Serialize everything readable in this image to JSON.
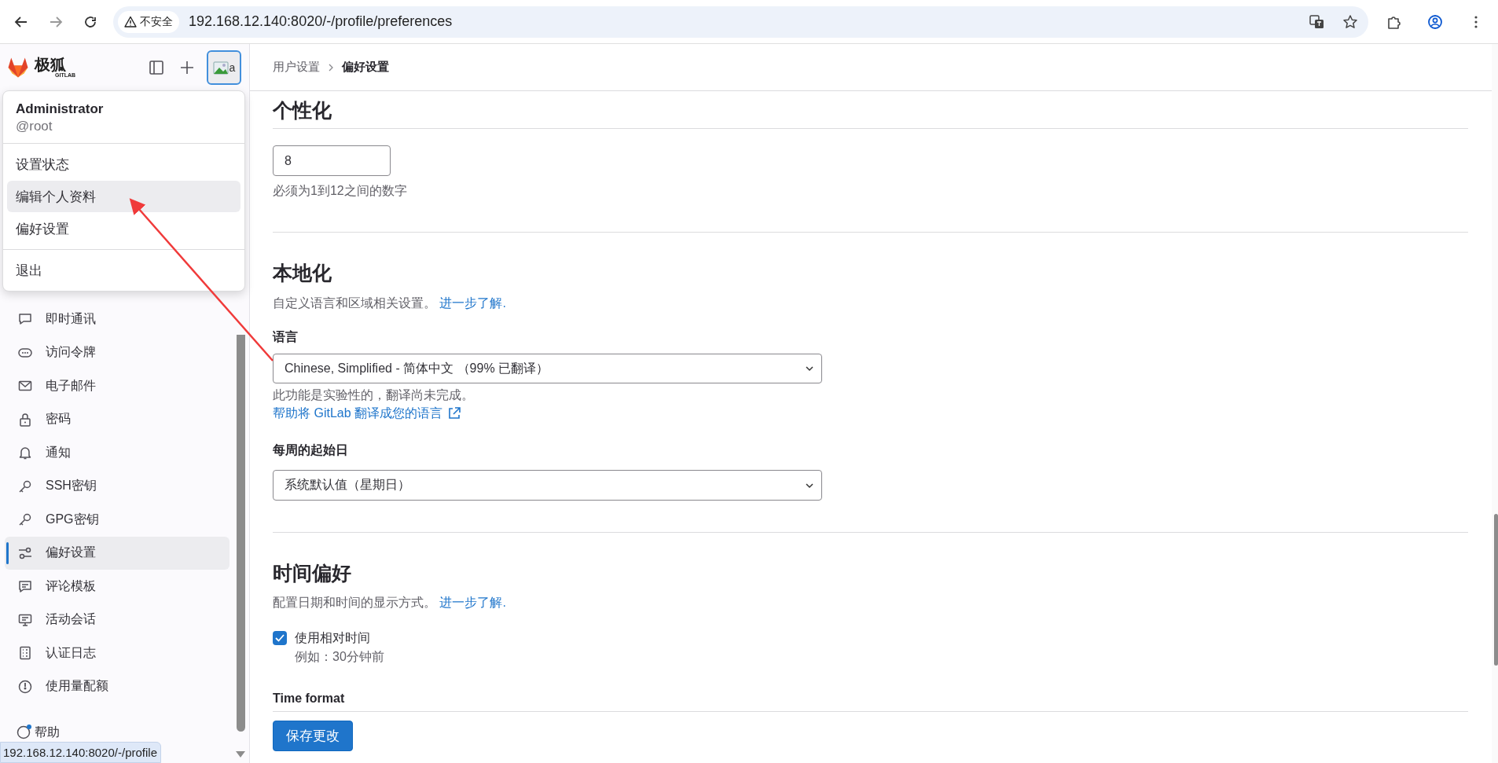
{
  "browser": {
    "security_label": "不安全",
    "url": "192.168.12.140:8020/-/profile/preferences"
  },
  "sidebar": {
    "brand": "极狐",
    "brand_sub": "GITLAB",
    "avatar_alt": "a",
    "items": [
      {
        "label": "即时通讯",
        "selected": false
      },
      {
        "label": "访问令牌",
        "selected": false
      },
      {
        "label": "电子邮件",
        "selected": false
      },
      {
        "label": "密码",
        "selected": false
      },
      {
        "label": "通知",
        "selected": false
      },
      {
        "label": "SSH密钥",
        "selected": false
      },
      {
        "label": "GPG密钥",
        "selected": false
      },
      {
        "label": "偏好设置",
        "selected": true
      },
      {
        "label": "评论模板",
        "selected": false
      },
      {
        "label": "活动会话",
        "selected": false
      },
      {
        "label": "认证日志",
        "selected": false
      },
      {
        "label": "使用量配额",
        "selected": false
      }
    ],
    "help": "帮助"
  },
  "user_menu": {
    "name": "Administrator",
    "username": "@root",
    "items": [
      {
        "label": "设置状态",
        "selected": false
      },
      {
        "label": "编辑个人资料",
        "selected": true
      },
      {
        "label": "偏好设置",
        "selected": false
      }
    ],
    "sign_out": "退出"
  },
  "breadcrumb": [
    "用户设置",
    "偏好设置"
  ],
  "personalization": {
    "title": "个性化",
    "value": "8",
    "help": "必须为1到12之间的数字"
  },
  "localization": {
    "title": "本地化",
    "description": "自定义语言和区域相关设置。",
    "learn_more": "进一步了解.",
    "language_label": "语言",
    "language_value": "Chinese, Simplified - 简体中文 （99% 已翻译）",
    "note": "此功能是实验性的，翻译尚未完成。",
    "help_link": "帮助将 GitLab 翻译成您的语言",
    "week_label": "每周的起始日",
    "week_value": "系统默认值（星期日）"
  },
  "time": {
    "title": "时间偏好",
    "description": "配置日期和时间的显示方式。",
    "learn_more": "进一步了解.",
    "relative_label": "使用相对时间",
    "relative_checked": true,
    "relative_hint": "例如：30分钟前",
    "format_label": "Time format"
  },
  "save_button": "保存更改",
  "status_url": "192.168.12.140:8020/-/profile"
}
